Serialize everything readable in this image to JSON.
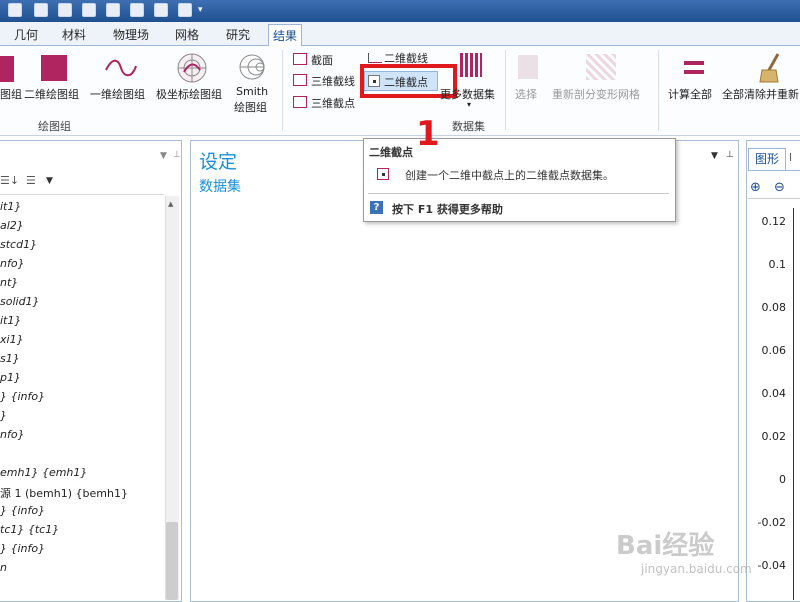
{
  "tabs": [
    {
      "label": "几何"
    },
    {
      "label": "材料"
    },
    {
      "label": "物理场"
    },
    {
      "label": "网格"
    },
    {
      "label": "研究"
    },
    {
      "label": "结果"
    }
  ],
  "ribbon": {
    "plot_group": {
      "items": [
        "图组",
        "二维绘图组",
        "一维绘图组",
        "极坐标绘图组"
      ],
      "smith_line1": "Smith",
      "smith_line2": "绘图组",
      "group_label": "绘图组"
    },
    "dataset": {
      "cut_plane": "截面",
      "cut_line_3d": "三维截线",
      "cut_point_3d": "三维截点",
      "cut_line_2d": "二维截线",
      "cut_point_2d": "二维截点",
      "more_datasets": "更多数据集",
      "group_label": "数据集"
    },
    "select": "选择",
    "remesh": "重新剖分变形网格",
    "compute_all": "计算全部",
    "clear_all": "全部清除并重新"
  },
  "annotation": {
    "number": "1",
    "color": "#e0191c"
  },
  "tooltip": {
    "title": "二维截点",
    "description": "创建一个二维中截点上的二维截点数据集。",
    "help": "按下 F1 获得更多帮助"
  },
  "tree": {
    "items": [
      "it1}",
      "al2}",
      "stcd1}",
      "nfo}",
      "nt}",
      "solid1}",
      "it1}",
      "xi1}",
      "s1}",
      "p1}",
      "} {info}",
      "}",
      "nfo}",
      "",
      "emh1} {emh1}",
      "源 1 (bemh1) {bemh1}",
      "} {info}",
      "tc1} {tc1}",
      "} {info}",
      "n"
    ]
  },
  "settings": {
    "title": "设定",
    "subtitle": "数据集"
  },
  "graphics": {
    "tab_label": "图形",
    "y_ticks": [
      "0.12",
      "0.1",
      "0.08",
      "0.06",
      "0.04",
      "0.02",
      "0",
      "-0.02",
      "-0.04"
    ]
  },
  "watermark": {
    "brand": "Bai经验",
    "url": "jingyan.baidu.com"
  },
  "colors": {
    "accent": "#1a8fd6",
    "magenta": "#b0245f",
    "highlight_border": "#e0191c"
  }
}
